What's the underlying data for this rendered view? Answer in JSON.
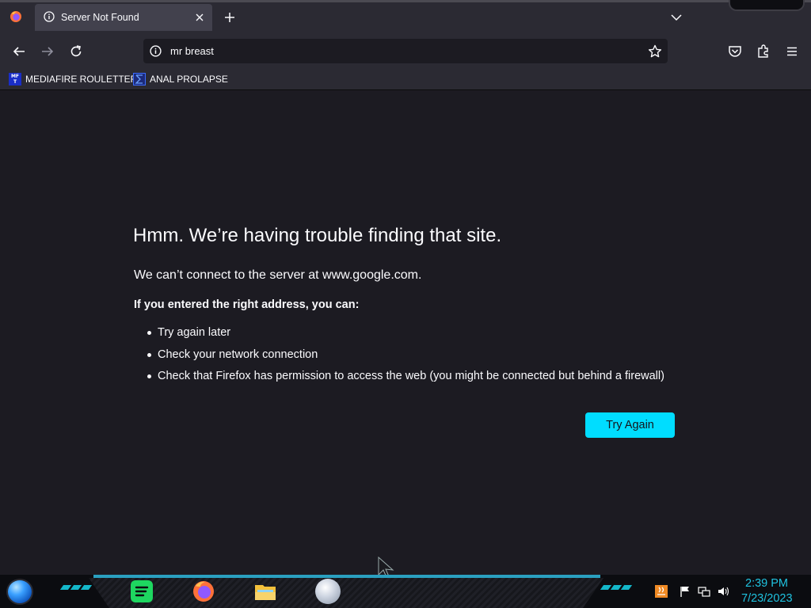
{
  "browser": {
    "tab": {
      "title": "Server Not Found"
    },
    "url": {
      "value": "mr breast"
    },
    "bookmarks": [
      {
        "label": "MEDIAFIRE ROULETTER",
        "icon": "mediafire-icon"
      },
      {
        "label": "ANAL PROLAPSE",
        "icon": "sigma-icon"
      }
    ]
  },
  "error": {
    "title": "Hmm. We’re having trouble finding that site.",
    "description": "We can’t connect to the server at www.google.com.",
    "hint": "If you entered the right address, you can:",
    "suggestions": [
      "Try again later",
      "Check your network connection",
      "Check that Firefox has permission to access the web (you might be connected but behind a firewall)"
    ],
    "button_label": "Try Again"
  },
  "taskbar": {
    "time": "2:39 PM",
    "date": "7/23/2023",
    "apps": [
      "start-orb",
      "spotify-icon",
      "firefox-icon",
      "file-explorer-icon",
      "sphere-icon"
    ]
  },
  "colors": {
    "accent": "#00ddff",
    "page_bg": "#1c1b22",
    "toolbar_bg": "#2b2a33",
    "clock": "#1fc3e0"
  },
  "bookmark_icon_text": "MF\nT"
}
